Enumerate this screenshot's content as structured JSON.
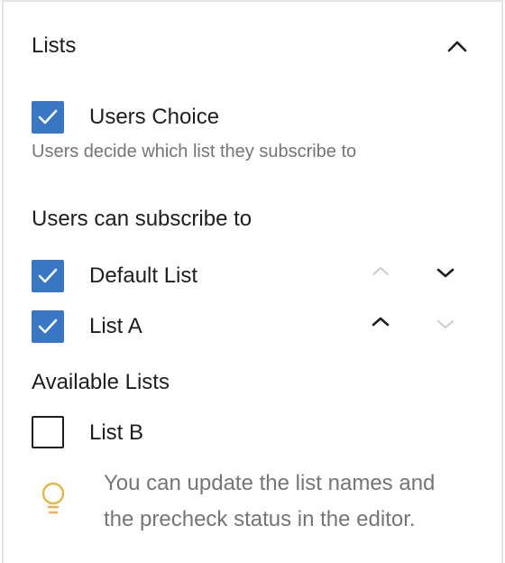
{
  "panel": {
    "title": "Lists"
  },
  "users_choice": {
    "label": "Users Choice",
    "checked": true,
    "help": "Users decide which list they subscribe to"
  },
  "subscribe": {
    "heading": "Users can subscribe to",
    "items": [
      {
        "label": "Default List",
        "checked": true,
        "move_up_enabled": false,
        "move_down_enabled": true
      },
      {
        "label": "List A",
        "checked": true,
        "move_up_enabled": true,
        "move_down_enabled": false
      }
    ]
  },
  "available": {
    "heading": "Available Lists",
    "items": [
      {
        "label": "List B",
        "checked": false
      }
    ]
  },
  "tip": {
    "line1": "You can update the list names and",
    "line2": "the precheck status in the editor."
  },
  "colors": {
    "checkbox_checked": "#3877c4",
    "arrow_enabled": "#1e1e1e",
    "arrow_disabled": "#c9ccd1",
    "bulb": "#e9b44c"
  }
}
